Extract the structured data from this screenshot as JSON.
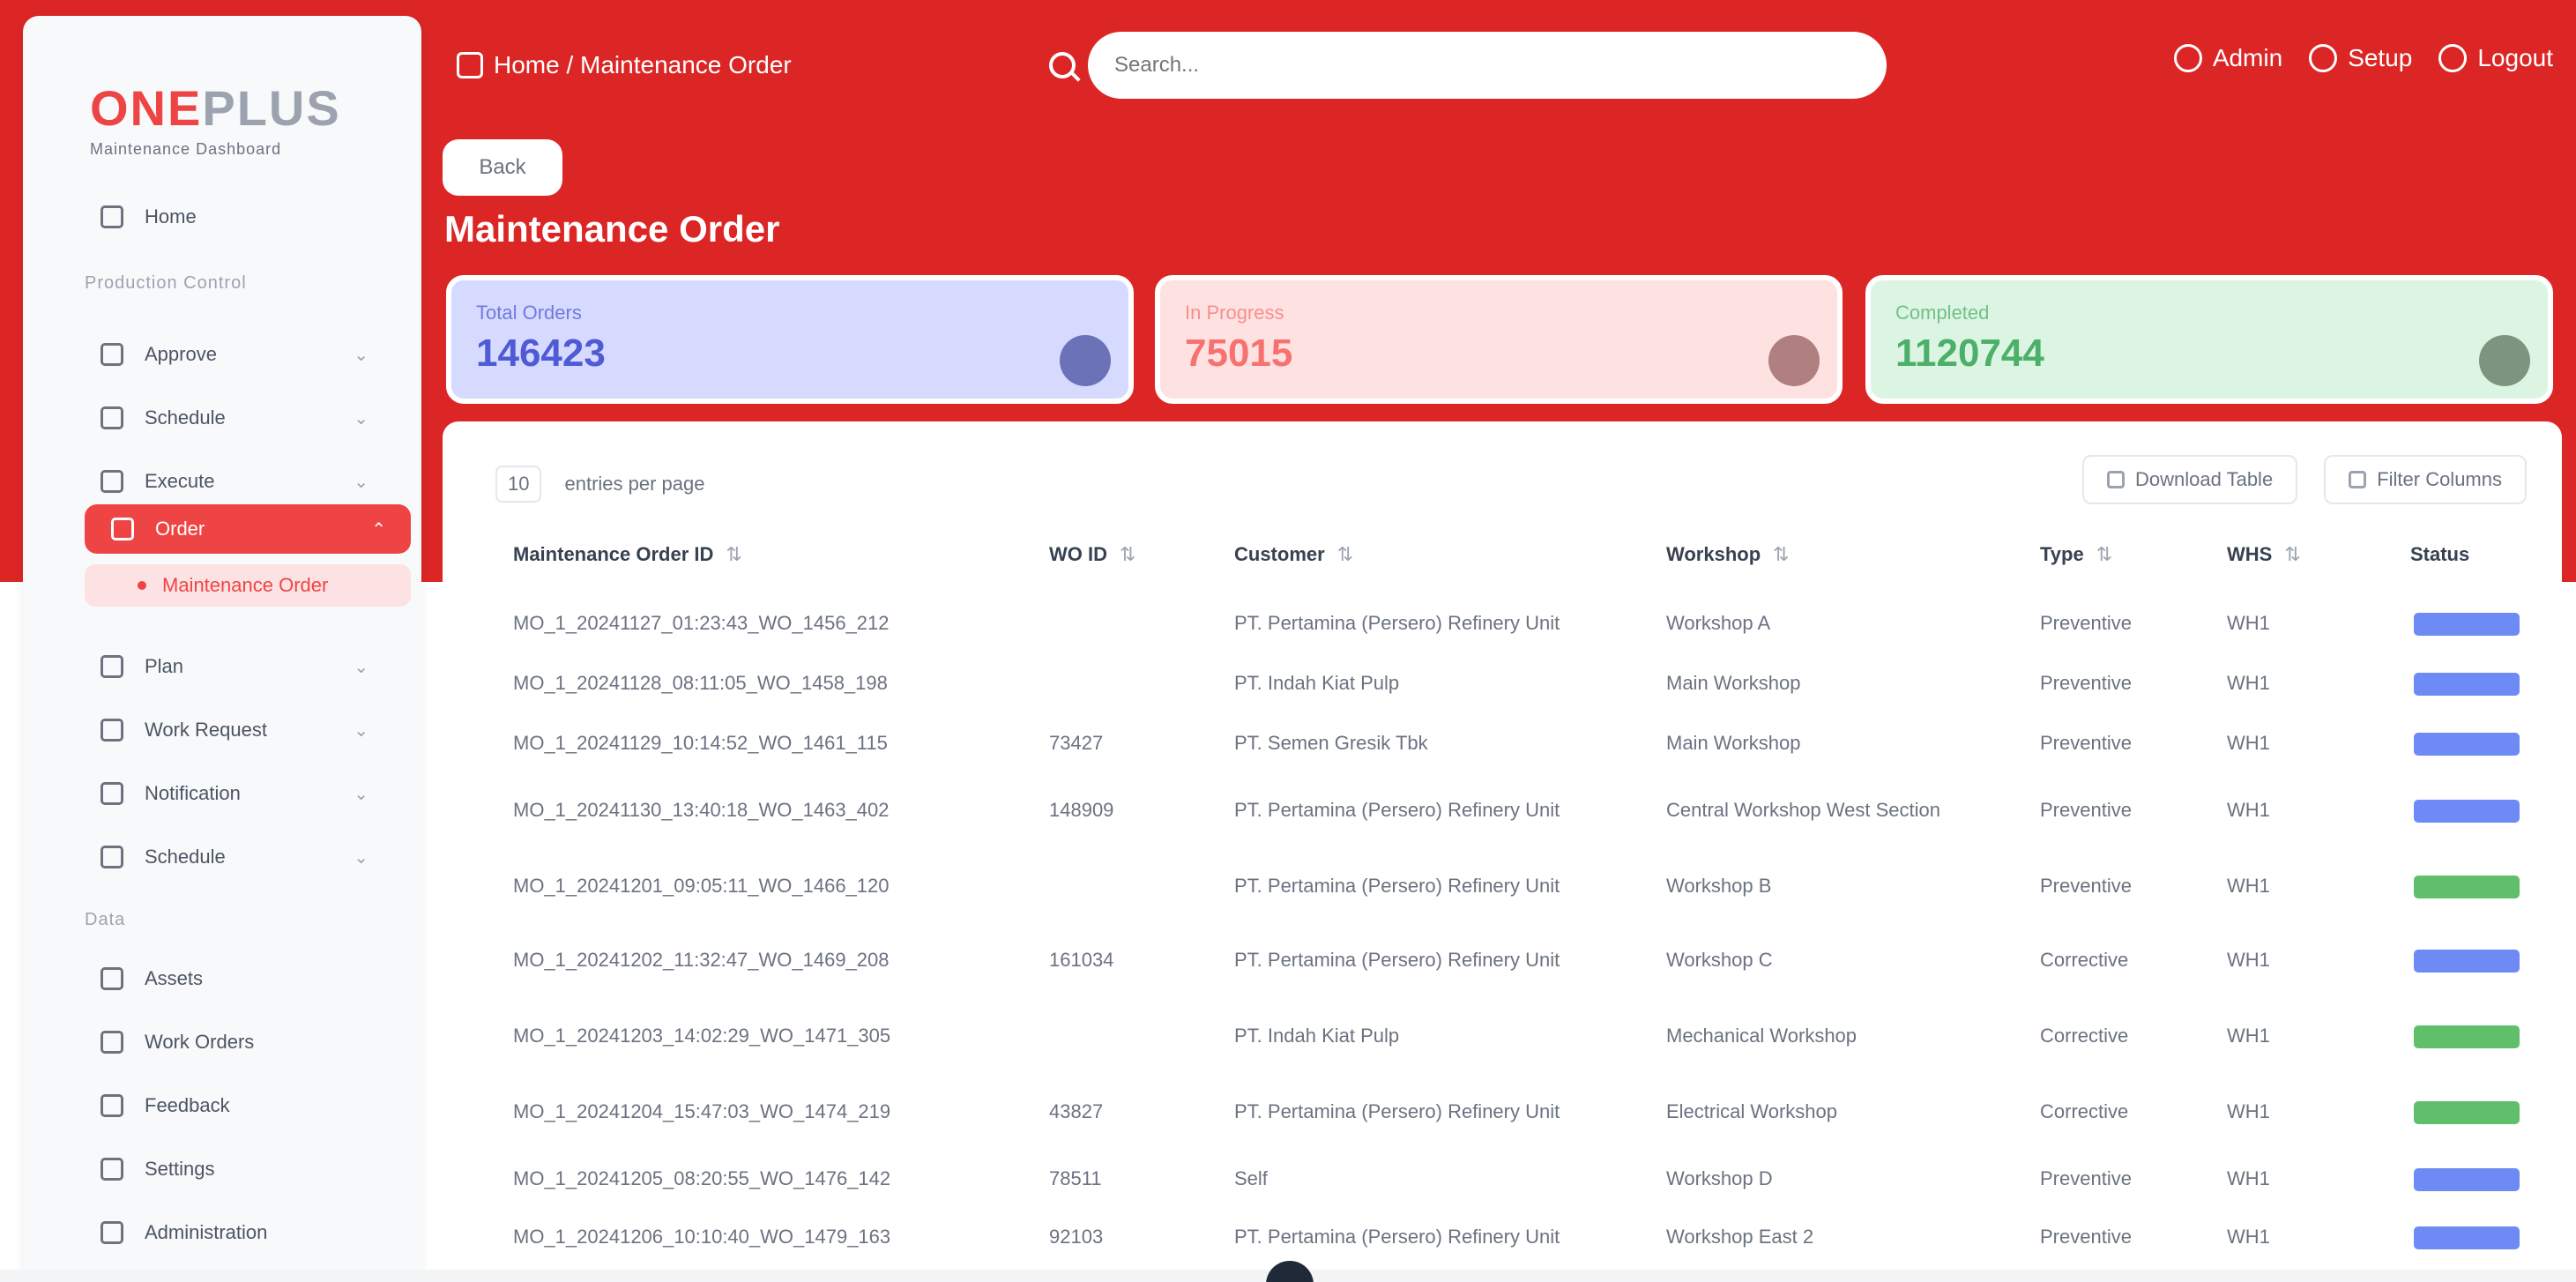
{
  "sidebar": {
    "logo": {
      "brand_a": "ONE",
      "brand_b": "PLUS",
      "subtitle": "Maintenance Dashboard"
    },
    "home_label": "Home",
    "section_main": "Production Control",
    "items_main": [
      {
        "label": "Approve",
        "expandable": true
      },
      {
        "label": "Schedule",
        "expandable": true
      },
      {
        "label": "Execute",
        "expandable": true
      },
      {
        "label": "Order",
        "expandable": true,
        "active": true
      }
    ],
    "active_sub": "Maintenance Order",
    "items_more": [
      {
        "label": "Plan",
        "expandable": true
      },
      {
        "label": "Work Request",
        "expandable": true
      },
      {
        "label": "Notification",
        "expandable": true
      },
      {
        "label": "Schedule",
        "expandable": true
      }
    ],
    "section_other": "Data",
    "items_other": [
      {
        "label": "Assets"
      },
      {
        "label": "Work Orders"
      },
      {
        "label": "Feedback"
      },
      {
        "label": "Settings"
      },
      {
        "label": "Administration"
      }
    ]
  },
  "header": {
    "left_label": "Home / Maintenance Order",
    "search_placeholder": "Search...",
    "right": [
      "Admin",
      "Setup",
      "Logout"
    ]
  },
  "page": {
    "back_label": "Back",
    "title": "Maintenance Order"
  },
  "stats": [
    {
      "label": "Total Orders",
      "value": "146423",
      "color": "#4f5bd5"
    },
    {
      "label": "In Progress",
      "value": "75015",
      "color": "#f87171"
    },
    {
      "label": "Completed",
      "value": "1120744",
      "color": "#4caf6a"
    }
  ],
  "table": {
    "page_size": "10",
    "page_size_label": "entries per page",
    "actions": [
      "Download Table",
      "Filter Columns"
    ],
    "columns": [
      "Maintenance Order ID",
      "WO ID",
      "Customer",
      "Workshop",
      "Type",
      "WHS",
      "Status"
    ],
    "rows": [
      {
        "id": "MO_1_20241127_01:23:43_WO_1456_212",
        "wo": "",
        "customer": "PT. Pertamina (Persero) Refinery Unit",
        "workshop": "Workshop A",
        "type": "Preventive",
        "whs": "WH1",
        "status": "blue"
      },
      {
        "id": "MO_1_20241128_08:11:05_WO_1458_198",
        "wo": "",
        "customer": "PT. Indah Kiat Pulp",
        "workshop": "Main Workshop",
        "type": "Preventive",
        "whs": "WH1",
        "status": "blue"
      },
      {
        "id": "MO_1_20241129_10:14:52_WO_1461_115",
        "wo": "73427",
        "customer": "PT. Semen Gresik Tbk",
        "workshop": "Main Workshop",
        "type": "Preventive",
        "whs": "WH1",
        "status": "blue"
      },
      {
        "id": "MO_1_20241130_13:40:18_WO_1463_402",
        "wo": "148909",
        "customer": "PT. Pertamina (Persero) Refinery Unit",
        "workshop": "Central Workshop West Section",
        "type": "Preventive",
        "whs": "WH1",
        "status": "blue"
      },
      {
        "id": "MO_1_20241201_09:05:11_WO_1466_120",
        "wo": "",
        "customer": "PT. Pertamina (Persero) Refinery Unit",
        "workshop": "Workshop B",
        "type": "Preventive",
        "whs": "WH1",
        "status": "green"
      },
      {
        "id": "MO_1_20241202_11:32:47_WO_1469_208",
        "wo": "161034",
        "customer": "PT. Pertamina (Persero) Refinery Unit",
        "workshop": "Workshop C",
        "type": "Corrective",
        "whs": "WH1",
        "status": "blue"
      },
      {
        "id": "MO_1_20241203_14:02:29_WO_1471_305",
        "wo": "",
        "customer": "PT. Indah Kiat Pulp",
        "workshop": "Mechanical Workshop",
        "type": "Corrective",
        "whs": "WH1",
        "status": "green"
      },
      {
        "id": "MO_1_20241204_15:47:03_WO_1474_219",
        "wo": "43827",
        "customer": "PT. Pertamina (Persero) Refinery Unit",
        "workshop": "Electrical Workshop",
        "type": "Corrective",
        "whs": "WH1",
        "status": "green"
      },
      {
        "id": "MO_1_20241205_08:20:55_WO_1476_142",
        "wo": "78511",
        "customer": "Self",
        "workshop": "Workshop D",
        "type": "Preventive",
        "whs": "WH1",
        "status": "blue"
      },
      {
        "id": "MO_1_20241206_10:10:40_WO_1479_163",
        "wo": "92103",
        "customer": "PT. Pertamina (Persero) Refinery Unit",
        "workshop": "Workshop East 2",
        "type": "Preventive",
        "whs": "WH1",
        "status": "blue"
      }
    ]
  }
}
